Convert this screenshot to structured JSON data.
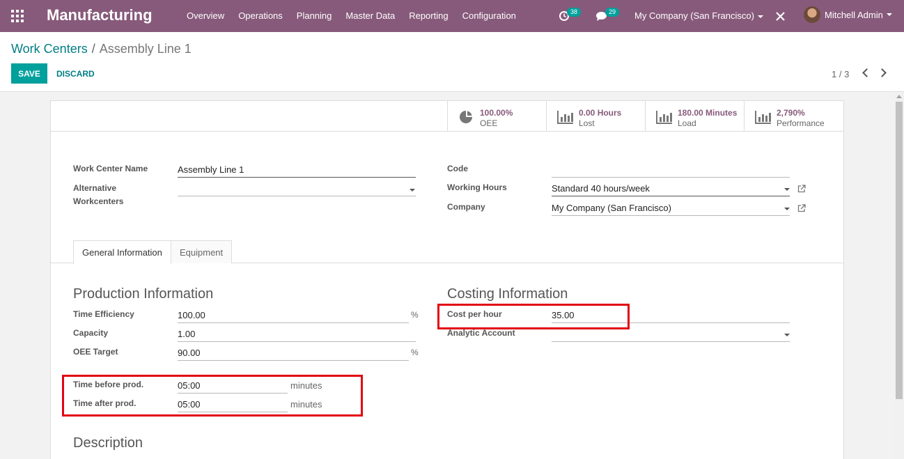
{
  "app": {
    "title": "Manufacturing",
    "menu": [
      "Overview",
      "Operations",
      "Planning",
      "Master Data",
      "Reporting",
      "Configuration"
    ],
    "activity_count": "38",
    "messages_count": "29",
    "company": "My Company (San Francisco)",
    "user": "Mitchell Admin"
  },
  "breadcrumb": {
    "parent": "Work Centers",
    "current": "Assembly Line 1"
  },
  "buttons": {
    "save": "SAVE",
    "discard": "DISCARD"
  },
  "pager": "1 / 3",
  "stats": [
    {
      "value": "100.00%",
      "label": "OEE",
      "icon": "pie-chart-icon"
    },
    {
      "value": "0.00 Hours",
      "label": "Lost",
      "icon": "bar-chart-icon"
    },
    {
      "value": "180.00 Minutes",
      "label": "Load",
      "icon": "bar-chart-icon"
    },
    {
      "value": "2,790%",
      "label": "Performance",
      "icon": "bar-chart-icon"
    }
  ],
  "form": {
    "work_center_name_label": "Work Center Name",
    "work_center_name": "Assembly Line 1",
    "alt_workcenters_label_1": "Alternative",
    "alt_workcenters_label_2": "Workcenters",
    "code_label": "Code",
    "code": "",
    "working_hours_label": "Working Hours",
    "working_hours": "Standard 40 hours/week",
    "company_label": "Company",
    "company": "My Company (San Francisco)"
  },
  "tabs": [
    "General Information",
    "Equipment"
  ],
  "production": {
    "title": "Production Information",
    "time_efficiency_label": "Time Efficiency",
    "time_efficiency": "100.00",
    "capacity_label": "Capacity",
    "capacity": "1.00",
    "oee_target_label": "OEE Target",
    "oee_target": "90.00",
    "percent": "%",
    "time_before_label": "Time before prod.",
    "time_before": "05:00",
    "time_after_label": "Time after prod.",
    "time_after": "05:00",
    "minutes": "minutes"
  },
  "costing": {
    "title": "Costing Information",
    "cost_per_hour_label": "Cost per hour",
    "cost_per_hour": "35.00",
    "analytic_account_label": "Analytic Account"
  },
  "description_title": "Description",
  "colors": {
    "navbar": "#875a7b",
    "accent": "#00a09d",
    "highlight": "#e20613"
  }
}
